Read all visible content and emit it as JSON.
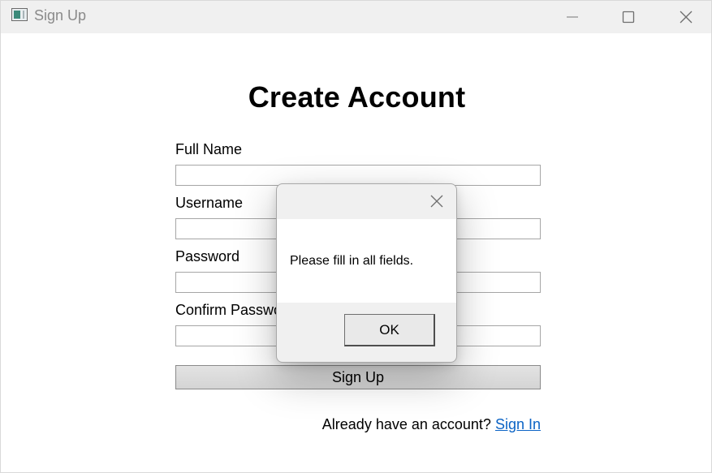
{
  "window": {
    "title": "Sign Up",
    "icons": {
      "minimize": "minimize-icon",
      "maximize": "maximize-icon",
      "close": "close-icon"
    }
  },
  "form": {
    "heading": "Create Account",
    "fields": [
      {
        "label": "Full Name",
        "value": ""
      },
      {
        "label": "Username",
        "value": ""
      },
      {
        "label": "Password",
        "value": ""
      },
      {
        "label": "Confirm Password",
        "value": ""
      }
    ],
    "submit_label": "Sign Up",
    "signin_prompt": "Already have an account?",
    "signin_link": "Sign In",
    "colors": {
      "link": "#0b63c5",
      "button_bg": "#dcdcdc"
    }
  },
  "dialog": {
    "message": "Please fill in all fields.",
    "ok_label": "OK",
    "close_icon": "close-icon"
  }
}
